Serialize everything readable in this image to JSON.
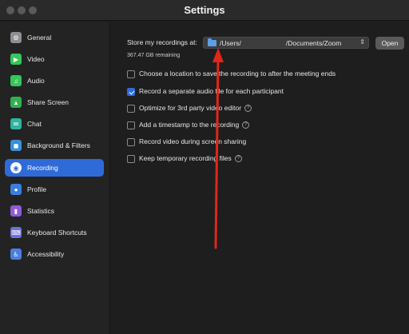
{
  "window": {
    "title": "Settings"
  },
  "sidebar": {
    "items": [
      {
        "label": "General",
        "icon": "gear-icon",
        "color": "#8e8e93",
        "glyph": "⚙"
      },
      {
        "label": "Video",
        "icon": "video-icon",
        "color": "#34c759",
        "glyph": "▶"
      },
      {
        "label": "Audio",
        "icon": "headphones-icon",
        "color": "#34c759",
        "glyph": "♫"
      },
      {
        "label": "Share Screen",
        "icon": "share-screen-icon",
        "color": "#30b050",
        "glyph": "▲"
      },
      {
        "label": "Chat",
        "icon": "chat-icon",
        "color": "#2fb5a0",
        "glyph": "✉"
      },
      {
        "label": "Background & Filters",
        "icon": "background-icon",
        "color": "#3a8fd9",
        "glyph": "◼"
      },
      {
        "label": "Recording",
        "icon": "recording-icon",
        "color": "#2f6ad9",
        "glyph": "◉",
        "active": true
      },
      {
        "label": "Profile",
        "icon": "profile-icon",
        "color": "#3a7fe0",
        "glyph": "●"
      },
      {
        "label": "Statistics",
        "icon": "statistics-icon",
        "color": "#8e5bd9",
        "glyph": "▮"
      },
      {
        "label": "Keyboard Shortcuts",
        "icon": "keyboard-icon",
        "color": "#6f6fd9",
        "glyph": "⌨"
      },
      {
        "label": "Accessibility",
        "icon": "accessibility-icon",
        "color": "#4a7fe0",
        "glyph": "♿"
      }
    ]
  },
  "recording": {
    "store_label": "Store my recordings at:",
    "path_prefix": "/Users/",
    "path_suffix": "/Documents/Zoom",
    "remaining": "367.47 GB remaining",
    "open_label": "Open",
    "options": [
      {
        "label": "Choose a location to save the recording to after the meeting ends",
        "checked": false,
        "help": false
      },
      {
        "label": "Record a separate audio file for each participant",
        "checked": true,
        "help": false
      },
      {
        "label": "Optimize for 3rd party video editor",
        "checked": false,
        "help": true
      },
      {
        "label": "Add a timestamp to the recording",
        "checked": false,
        "help": true
      },
      {
        "label": "Record video during screen sharing",
        "checked": false,
        "help": false
      },
      {
        "label": "Keep temporary recording files",
        "checked": false,
        "help": true
      }
    ]
  },
  "colors": {
    "accent": "#2f6ad9",
    "annotation_arrow": "#e0271a"
  }
}
